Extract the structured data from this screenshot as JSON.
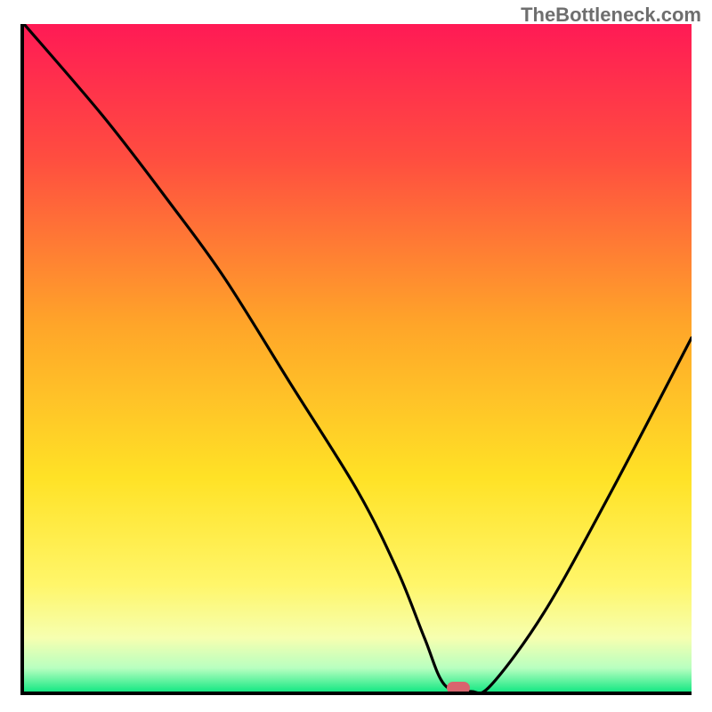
{
  "attribution": "TheBottleneck.com",
  "plot": {
    "x_range": [
      0,
      100
    ],
    "y_range": [
      0,
      100
    ],
    "gradient_stops": [
      {
        "offset": 0,
        "color": "#ff1a55"
      },
      {
        "offset": 0.2,
        "color": "#ff4d40"
      },
      {
        "offset": 0.45,
        "color": "#ffa529"
      },
      {
        "offset": 0.68,
        "color": "#ffe226"
      },
      {
        "offset": 0.84,
        "color": "#fff66a"
      },
      {
        "offset": 0.92,
        "color": "#f6ffb0"
      },
      {
        "offset": 0.965,
        "color": "#b8ffc0"
      },
      {
        "offset": 1.0,
        "color": "#17e884"
      }
    ]
  },
  "chart_data": {
    "type": "line",
    "title": "",
    "xlabel": "",
    "ylabel": "",
    "xlim": [
      0,
      100
    ],
    "ylim": [
      0,
      100
    ],
    "series": [
      {
        "name": "bottleneck-curve",
        "x": [
          0,
          12,
          22,
          30,
          40,
          50,
          56,
          60,
          63,
          67,
          70,
          78,
          88,
          100
        ],
        "y": [
          100,
          86,
          73,
          62,
          46,
          30,
          18,
          8,
          1,
          0,
          1,
          12,
          30,
          53
        ]
      }
    ],
    "annotations": [
      {
        "name": "optimum-marker",
        "x": 65,
        "y": 0.5
      }
    ]
  }
}
